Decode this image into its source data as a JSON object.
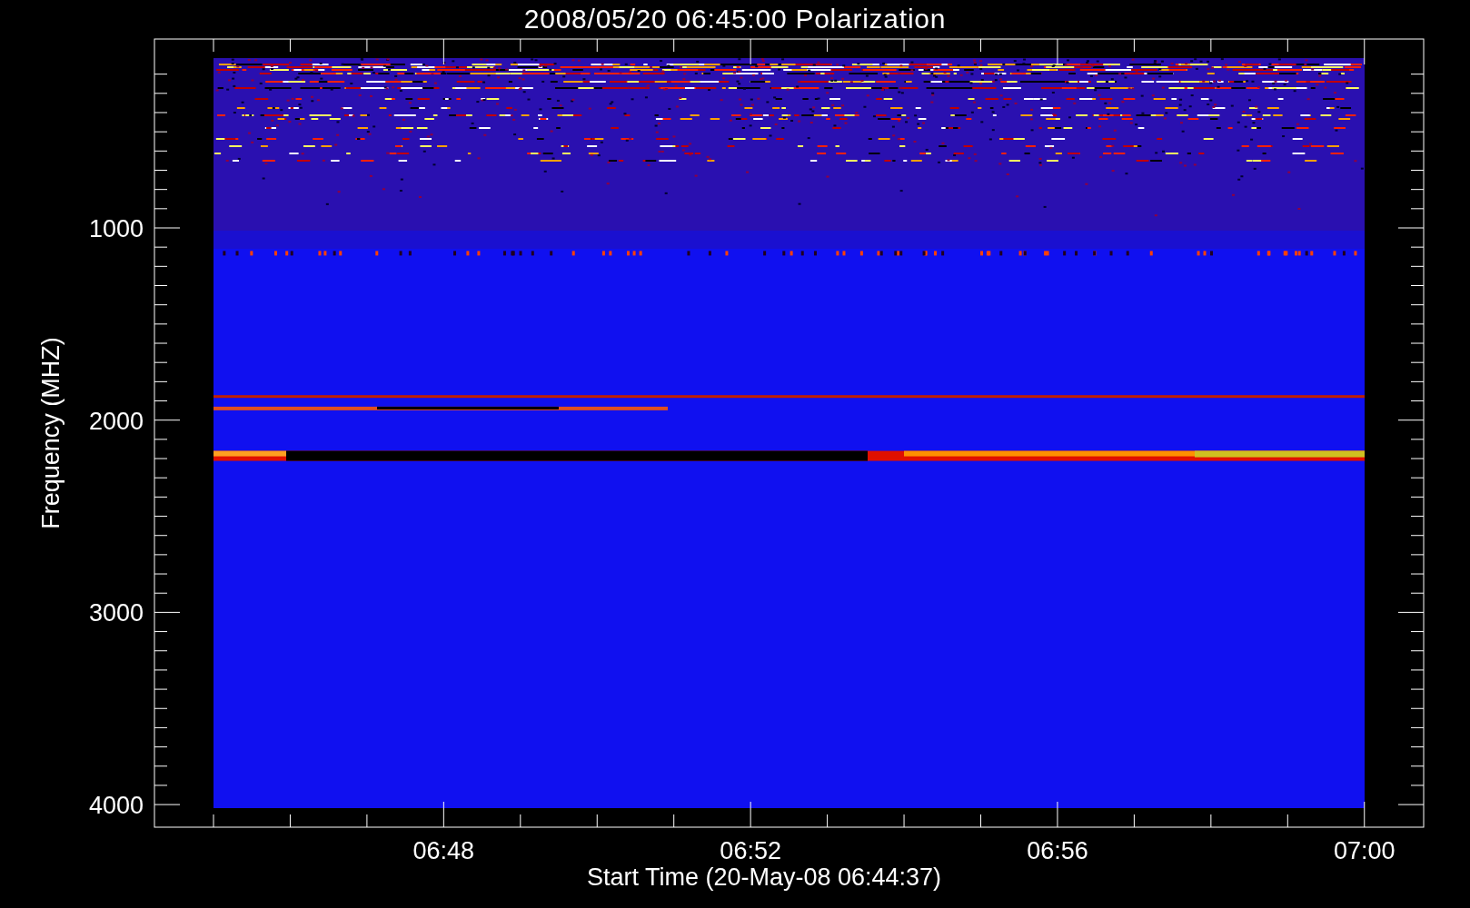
{
  "plot": {
    "title": "2008/05/20 06:45:00 Polarization",
    "ylabel": "Frequency (MHZ)",
    "xlabel": "Start Time (20-May-08 06:44:37)",
    "yticks": [
      "1000",
      "2000",
      "3000",
      "4000"
    ],
    "xticks": [
      "06:48",
      "06:52",
      "06:56",
      "07:00"
    ]
  }
}
